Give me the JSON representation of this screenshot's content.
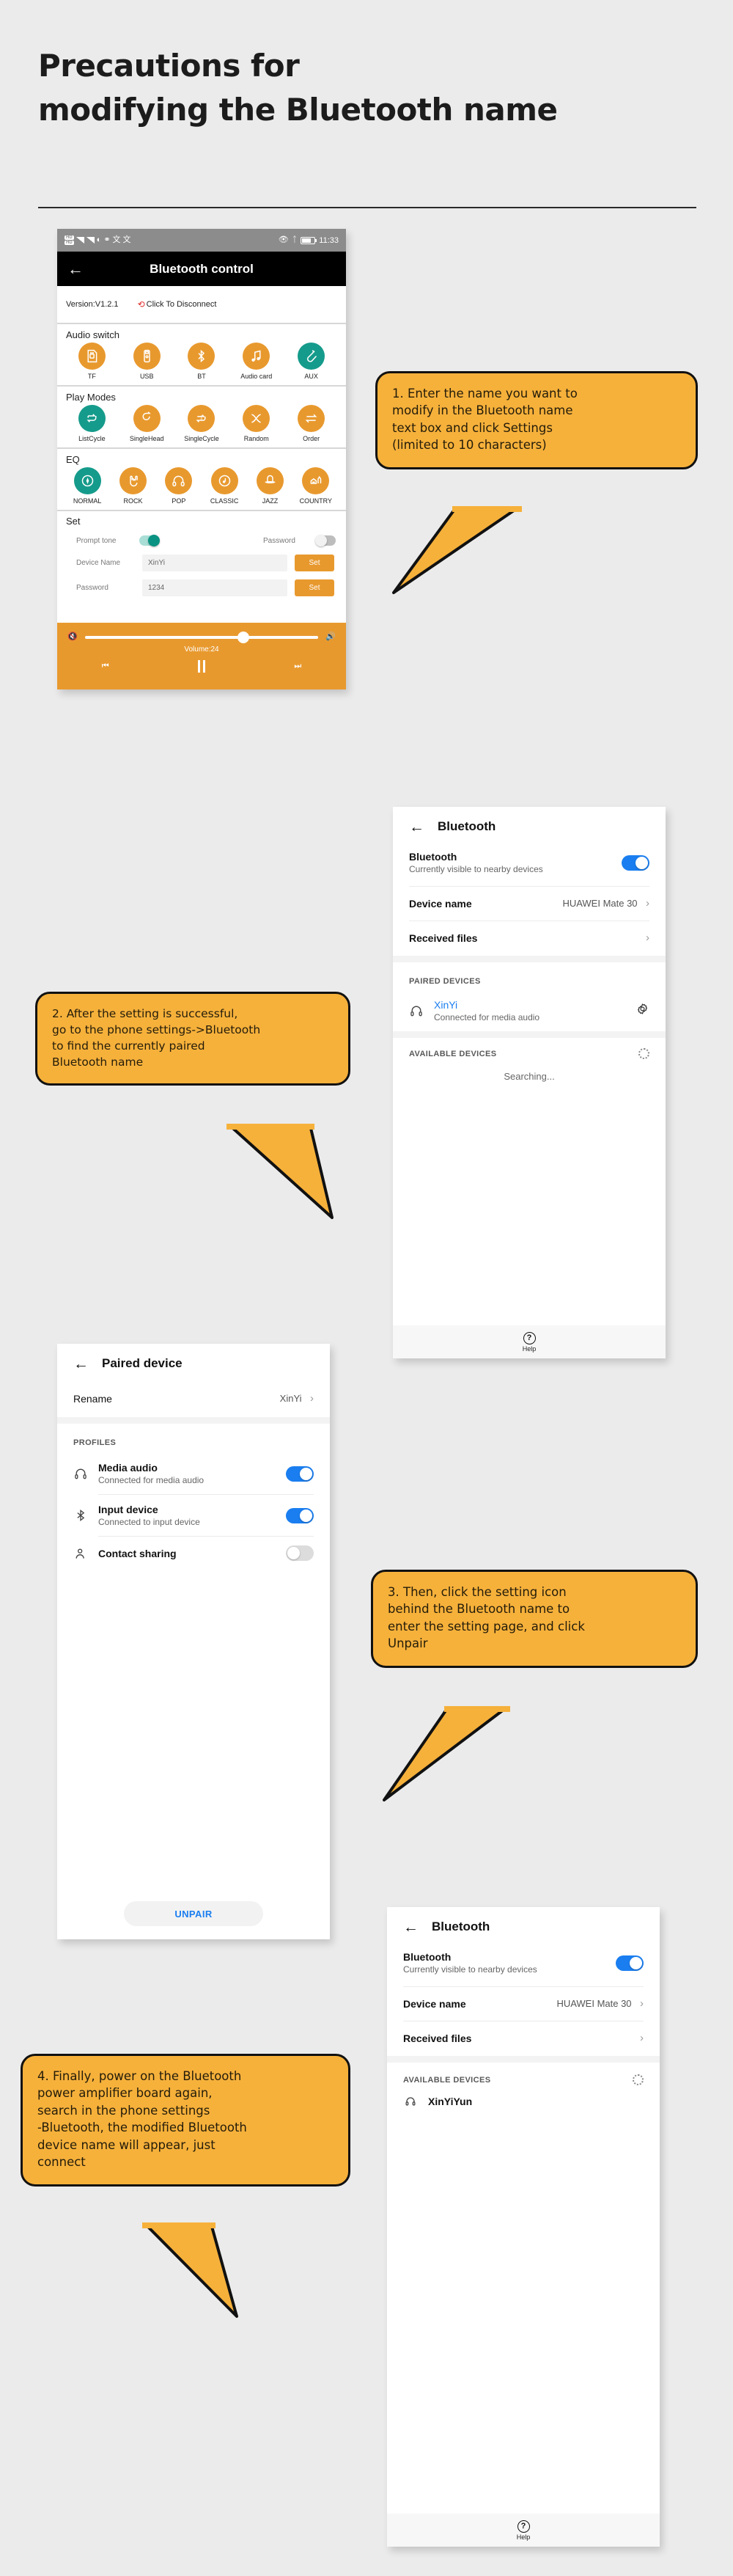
{
  "header": {
    "title": "Precautions for\nmodifying the Bluetooth name"
  },
  "colors": {
    "callout_fill": "#f6b13b",
    "callout_stroke": "#111111",
    "app_orange": "#e8992e",
    "app_teal": "#159b8b",
    "android_blue": "#1a7ef0",
    "page_background": "#ebebeb"
  },
  "phone1": {
    "status_bar": {
      "time": "11:33",
      "hd_badge": "HD",
      "network": "4G"
    },
    "app_bar": {
      "back_icon": "arrow-left-icon",
      "title": "Bluetooth control"
    },
    "version_row": {
      "version": "Version:V1.2.1",
      "disconnect_label": "Click To Disconnect",
      "refresh_icon": "refresh-icon"
    },
    "audio_switch": {
      "title": "Audio switch",
      "items": [
        {
          "label": "TF",
          "icon": "sd-card-icon",
          "active": false
        },
        {
          "label": "USB",
          "icon": "usb-drive-icon",
          "active": false
        },
        {
          "label": "BT",
          "icon": "bluetooth-icon",
          "active": false
        },
        {
          "label": "Audio card",
          "icon": "music-note-icon",
          "active": false
        },
        {
          "label": "AUX",
          "icon": "aux-cable-icon",
          "active": true
        }
      ]
    },
    "play_modes": {
      "title": "Play Modes",
      "items": [
        {
          "label": "ListCycle",
          "icon": "repeat-list-icon",
          "active": true
        },
        {
          "label": "SingleHead",
          "icon": "repeat-once-arrow-icon",
          "active": false
        },
        {
          "label": "SingleCycle",
          "icon": "repeat-one-icon",
          "active": false
        },
        {
          "label": "Random",
          "icon": "shuffle-icon",
          "active": false
        },
        {
          "label": "Order",
          "icon": "order-arrows-icon",
          "active": false
        }
      ]
    },
    "eq": {
      "title": "EQ",
      "items": [
        {
          "label": "NORMAL",
          "icon": "eq-normal-icon",
          "active": true
        },
        {
          "label": "ROCK",
          "icon": "rock-hand-icon",
          "active": false
        },
        {
          "label": "POP",
          "icon": "headphones-icon",
          "active": false
        },
        {
          "label": "CLASSIC",
          "icon": "vinyl-note-icon",
          "active": false
        },
        {
          "label": "JAZZ",
          "icon": "hat-icon",
          "active": false
        },
        {
          "label": "COUNTRY",
          "icon": "country-barn-icon",
          "active": false
        }
      ]
    },
    "set": {
      "title": "Set",
      "prompt_tone_label": "Prompt tone",
      "prompt_tone_on": true,
      "password_toggle_label": "Password",
      "password_toggle_on": false,
      "device_name_label": "Device Name",
      "device_name_value": "XinYi",
      "device_name_set_button": "Set",
      "password_label": "Password",
      "password_value": "1234",
      "password_set_button": "Set"
    },
    "player": {
      "mute_icon": "volume-mute-icon",
      "volume_up_icon": "volume-up-icon",
      "volume_label": "Volume:24",
      "volume_percent": 68,
      "prev_icon": "previous-track-icon",
      "pause_icon": "pause-icon",
      "next_icon": "next-track-icon"
    }
  },
  "phone2": {
    "back_icon": "arrow-left-icon",
    "title": "Bluetooth",
    "bluetooth_row": {
      "label": "Bluetooth",
      "sub": "Currently visible to nearby devices",
      "toggle_on": true
    },
    "device_name_row": {
      "label": "Device name",
      "value": "HUAWEI Mate 30",
      "chevron": "chevron-right-icon"
    },
    "received_files_row": {
      "label": "Received files",
      "chevron": "chevron-right-icon"
    },
    "paired_header": "PAIRED DEVICES",
    "paired_device": {
      "icon": "headphones-icon",
      "name": "XinYi",
      "status": "Connected for media audio",
      "settings_icon": "gear-icon"
    },
    "available_header": "AVAILABLE DEVICES",
    "searching_text": "Searching...",
    "help": {
      "icon": "question-circle-icon",
      "label": "Help"
    }
  },
  "phone3": {
    "back_icon": "arrow-left-icon",
    "title": "Paired device",
    "rename_row": {
      "label": "Rename",
      "value": "XinYi",
      "chevron": "chevron-right-icon"
    },
    "profiles_header": "PROFILES",
    "profiles": [
      {
        "icon": "headphones-icon",
        "label": "Media audio",
        "sub": "Connected for media audio",
        "toggle_on": true
      },
      {
        "icon": "bluetooth-icon",
        "label": "Input device",
        "sub": "Connected to input device",
        "toggle_on": true
      },
      {
        "icon": "contact-icon",
        "label": "Contact sharing",
        "sub": "",
        "toggle_on": false
      }
    ],
    "unpair_button": "UNPAIR"
  },
  "phone4": {
    "back_icon": "arrow-left-icon",
    "title": "Bluetooth",
    "bluetooth_row": {
      "label": "Bluetooth",
      "sub": "Currently visible to nearby devices",
      "toggle_on": true
    },
    "device_name_row": {
      "label": "Device name",
      "value": "HUAWEI Mate 30",
      "chevron": "chevron-right-icon"
    },
    "received_files_row": {
      "label": "Received files",
      "chevron": "chevron-right-icon"
    },
    "available_header": "AVAILABLE DEVICES",
    "available_device": {
      "icon": "headphones-icon",
      "name": "XinYiYun"
    },
    "help": {
      "icon": "question-circle-icon",
      "label": "Help"
    }
  },
  "callouts": {
    "step1": "1. Enter the name you want to\nmodify in the Bluetooth name\ntext box and click Settings\n(limited to 10 characters)",
    "step2": "2. After the setting is successful,\n go to the phone settings->Bluetooth\nto find the currently paired\nBluetooth name",
    "step3": "3. Then, click the setting icon\nbehind the Bluetooth name to\nenter the setting page, and click\nUnpair",
    "step4": "4. Finally, power on the Bluetooth\npower amplifier board again,\nsearch in the phone settings\n-Bluetooth, the modified Bluetooth\ndevice name will appear, just\nconnect"
  }
}
